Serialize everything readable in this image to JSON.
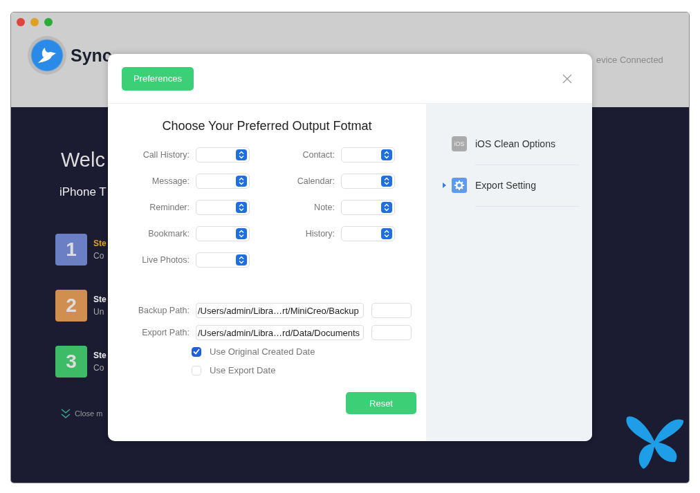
{
  "app": {
    "logo_text": "Sync",
    "device_status": "evice Connected",
    "welcome": "Welc",
    "subtitle": "iPhone T",
    "steps": [
      {
        "number": "1",
        "title": "Ste",
        "desc": "Co",
        "active": true,
        "color": "#6a7fc4"
      },
      {
        "number": "2",
        "title": "Ste",
        "desc": "Un",
        "active": false,
        "color": "#d18f4f"
      },
      {
        "number": "3",
        "title": "Ste",
        "desc": "Co",
        "active": false,
        "color": "#3dbb66"
      }
    ],
    "close_hint": "Close m"
  },
  "dialog": {
    "title_button": "Preferences",
    "heading": "Choose Your Preferred Output Fotmat",
    "formats": [
      {
        "label": "Call History:"
      },
      {
        "label": "Contact:"
      },
      {
        "label": "Message:"
      },
      {
        "label": "Calendar:"
      },
      {
        "label": "Reminder:"
      },
      {
        "label": "Note:"
      },
      {
        "label": "Bookmark:"
      },
      {
        "label": "History:"
      },
      {
        "label": "Live Photos:"
      }
    ],
    "paths": [
      {
        "label": "Backup Path:",
        "value": "/Users/admin/Libra…rt/MiniCreo/Backup"
      },
      {
        "label": "Export Path:",
        "value": "/Users/admin/Libra…rd/Data/Documents"
      }
    ],
    "options": [
      {
        "label": "Use Original Created Date",
        "checked": true
      },
      {
        "label": "Use Export Date",
        "checked": false
      }
    ],
    "reset": "Reset",
    "sidebar": [
      {
        "kind": "badge",
        "icon_text": "iOS",
        "label": "iOS Clean Options",
        "selected": false
      },
      {
        "kind": "gear",
        "label": "Export Setting",
        "selected": true
      }
    ]
  }
}
